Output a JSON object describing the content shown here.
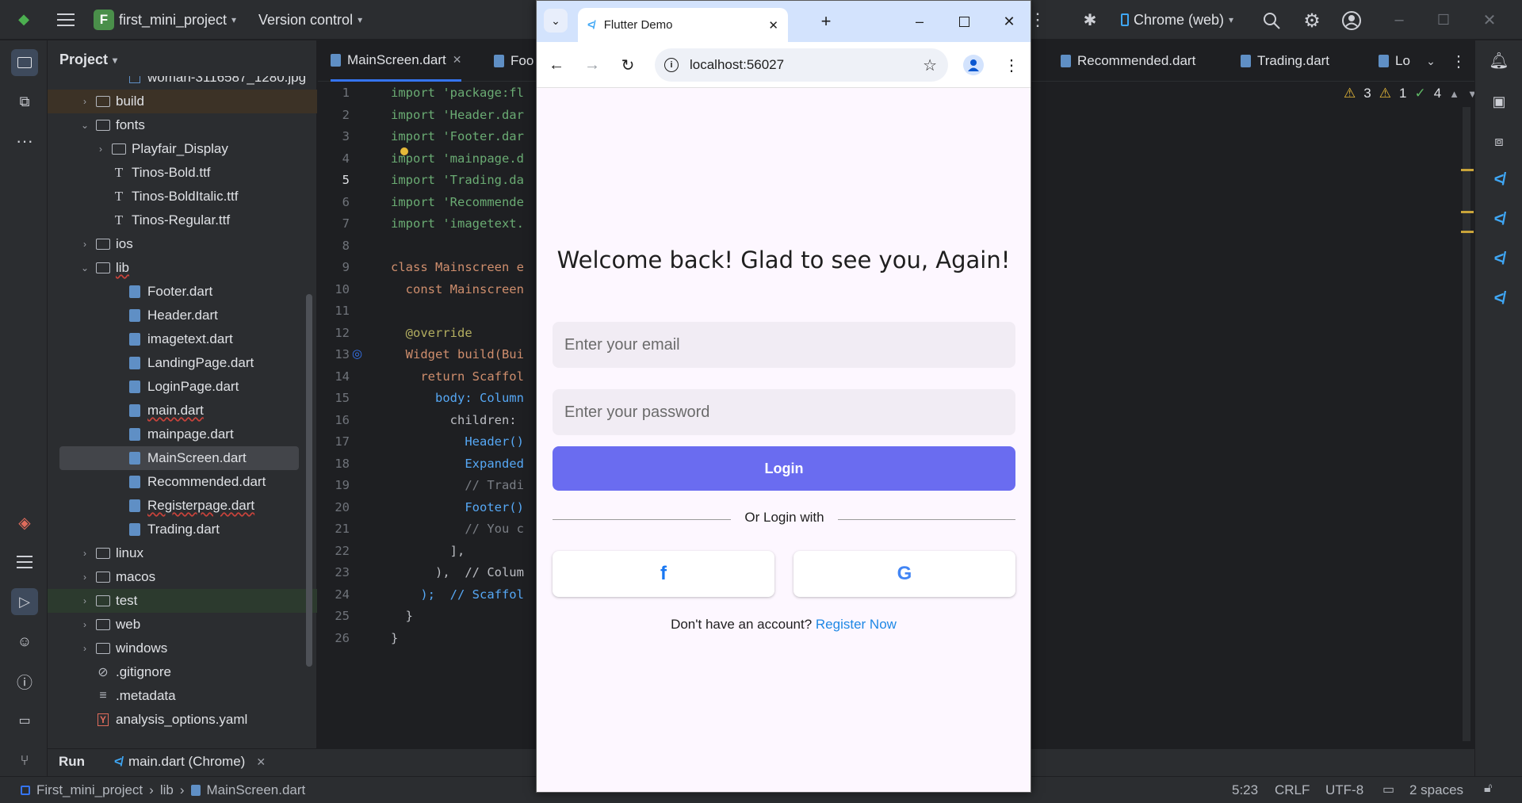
{
  "ide": {
    "project_badge": "F",
    "project_name": "first_mini_project",
    "version_control": "Version control",
    "run_config": "Chrome (web)",
    "panel_title": "Project",
    "tree": [
      {
        "label": "woman-3116587_1280.jpg",
        "type": "image"
      },
      {
        "label": "build",
        "type": "folder",
        "arrow": "›"
      },
      {
        "label": "fonts",
        "type": "folder",
        "arrow": "⌄"
      },
      {
        "label": "Playfair_Display",
        "type": "folder",
        "arrow": "›"
      },
      {
        "label": "Tinos-Bold.ttf",
        "type": "font"
      },
      {
        "label": "Tinos-BoldItalic.ttf",
        "type": "font"
      },
      {
        "label": "Tinos-Regular.ttf",
        "type": "font"
      },
      {
        "label": "ios",
        "type": "folder",
        "arrow": "›"
      },
      {
        "label": "lib",
        "type": "folder",
        "arrow": "⌄"
      },
      {
        "label": "Footer.dart",
        "type": "dart"
      },
      {
        "label": "Header.dart",
        "type": "dart"
      },
      {
        "label": "imagetext.dart",
        "type": "dart"
      },
      {
        "label": "LandingPage.dart",
        "type": "dart"
      },
      {
        "label": "LoginPage.dart",
        "type": "dart"
      },
      {
        "label": "main.dart",
        "type": "dart"
      },
      {
        "label": "mainpage.dart",
        "type": "dart"
      },
      {
        "label": "MainScreen.dart",
        "type": "dart"
      },
      {
        "label": "Recommended.dart",
        "type": "dart"
      },
      {
        "label": "Registerpage.dart",
        "type": "dart"
      },
      {
        "label": "Trading.dart",
        "type": "dart"
      },
      {
        "label": "linux",
        "type": "folder",
        "arrow": "›"
      },
      {
        "label": "macos",
        "type": "folder",
        "arrow": "›"
      },
      {
        "label": "test",
        "type": "folder",
        "arrow": "›"
      },
      {
        "label": "web",
        "type": "folder",
        "arrow": "›"
      },
      {
        "label": "windows",
        "type": "folder",
        "arrow": "›"
      },
      {
        "label": ".gitignore",
        "type": "ignore"
      },
      {
        "label": ".metadata",
        "type": "meta"
      },
      {
        "label": "analysis_options.yaml",
        "type": "yaml"
      }
    ],
    "tabs": [
      "MainScreen.dart",
      "Foo",
      "Recommended.dart",
      "Trading.dart",
      "Lo"
    ],
    "inspections": {
      "warn1": "3",
      "warn2": "1",
      "ok": "4"
    },
    "line_numbers": [
      "1",
      "2",
      "3",
      "4",
      "5",
      "6",
      "7",
      "8",
      "9",
      "10",
      "11",
      "12",
      "13",
      "14",
      "15",
      "16",
      "17",
      "18",
      "19",
      "20",
      "21",
      "22",
      "23",
      "24",
      "25",
      "26"
    ],
    "code_lines": [
      "import 'package:fl",
      "import 'Header.dar",
      "import 'Footer.dar",
      "import 'mainpage.d",
      "import 'Trading.da",
      "import 'Recommende",
      "import 'imagetext.",
      "",
      "class Mainscreen e",
      "  const Mainscreen",
      "",
      "  @override",
      "  Widget build(Bui",
      "    return Scaffol",
      "      body: Column",
      "        children:",
      "          Header()",
      "          Expanded",
      "          // Tradi",
      "          Footer()",
      "          // You c",
      "        ],",
      "      ),  // Colum",
      "    );  // Scaffol",
      "  }",
      "}"
    ],
    "run_label": "Run",
    "run_tab": "main.dart (Chrome)",
    "breadcrumb": [
      "First_mini_project",
      "lib",
      "MainScreen.dart"
    ],
    "status": {
      "position": "5:23",
      "line_sep": "CRLF",
      "encoding": "UTF-8",
      "indent": "2 spaces"
    }
  },
  "browser": {
    "tab_title": "Flutter Demo",
    "url": "localhost:56027"
  },
  "app": {
    "heading": "Welcome back! Glad to see you, Again!",
    "email_placeholder": "Enter your email",
    "password_placeholder": "Enter your password",
    "login_label": "Login",
    "divider_text": "Or Login with",
    "facebook_glyph": "f",
    "google_glyph": "G",
    "no_account": "Don't have an account?",
    "register_link": "Register Now"
  },
  "colors": {
    "accent": "#6a6cf0",
    "link": "#1e88e5",
    "facebook": "#1877f2"
  }
}
